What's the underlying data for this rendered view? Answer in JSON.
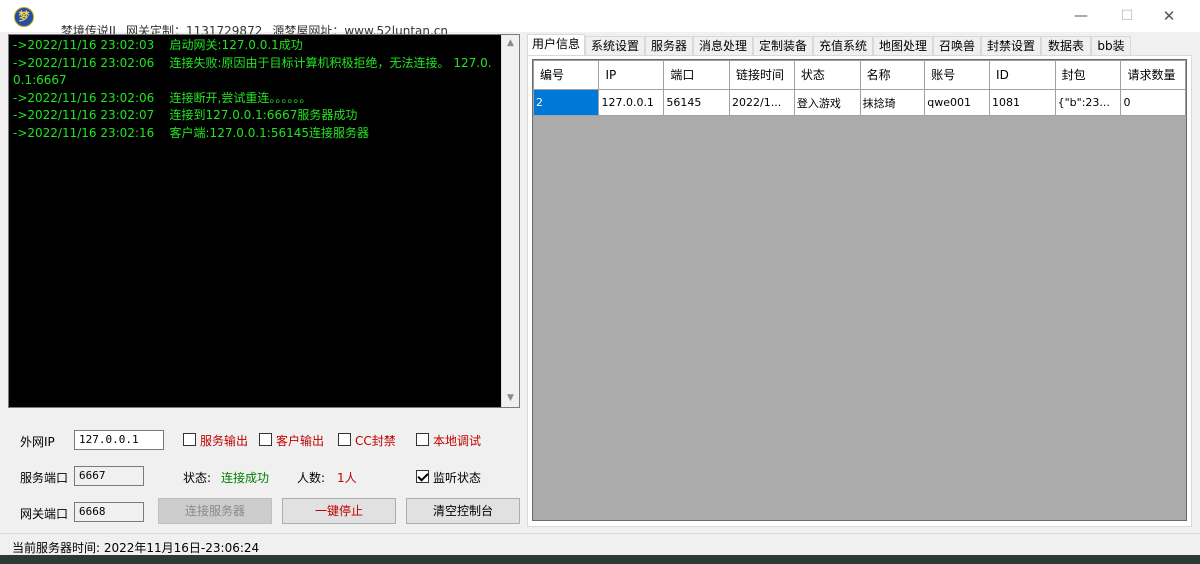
{
  "window": {
    "app_icon_glyph": "梦",
    "title_app": "梦境传说II",
    "title_gateway": "网关定制：1131729872",
    "title_site": "源梦屋网址：www.52luntan.cn",
    "minimize": "—",
    "maximize": "☐",
    "close": "✕"
  },
  "console": {
    "lines": [
      "->2022/11/16 23:02:03    启动网关:127.0.0.1成功",
      "->2022/11/16 23:02:06    连接失败:原因由于目标计算机积极拒绝，无法连接。 127.0.0.1:6667",
      "->2022/11/16 23:02:06    连接断开,尝试重连。。。。。。",
      "->2022/11/16 23:02:07    连接到127.0.0.1:6667服务器成功",
      "->2022/11/16 23:02:16    客户端:127.0.0.1:56145连接服务器"
    ],
    "scroll_up": "▲",
    "scroll_down": "▼"
  },
  "controls": {
    "wan_ip_label": "外网IP",
    "wan_ip_value": "127.0.0.1",
    "service_port_label": "服务端口",
    "service_port_value": "6667",
    "gateway_port_label": "网关端口",
    "gateway_port_value": "6668",
    "chk_service_output": "服务输出",
    "chk_client_output": "客户输出",
    "chk_cc_ban": "CC封禁",
    "chk_local_debug": "本地调试",
    "chk_listen_state": "监听状态",
    "status_label": "状态:",
    "status_value": "连接成功",
    "count_label": "人数:",
    "count_value": "1人",
    "btn_connect": "连接服务器",
    "btn_stop": "一键停止",
    "btn_clear": "清空控制台"
  },
  "statusbar": {
    "server_time": "当前服务器时间:  2022年11月16日-23:06:24"
  },
  "tabs": [
    "用户信息",
    "系统设置",
    "服务器",
    "消息处理",
    "定制装备",
    "充值系统",
    "地图处理",
    "召唤兽",
    "封禁设置",
    "数据表",
    "bb装"
  ],
  "table": {
    "headers": [
      "编号",
      "IP",
      "端口",
      "链接时间",
      "状态",
      "名称",
      "账号",
      "ID",
      "封包",
      "请求数量"
    ],
    "rows": [
      [
        "2",
        "127.0.0.1",
        "56145",
        "2022/1...",
        "登入游戏",
        "抹捻琦",
        "qwe001",
        "1081",
        "{\"b\":23...",
        "0"
      ]
    ]
  }
}
